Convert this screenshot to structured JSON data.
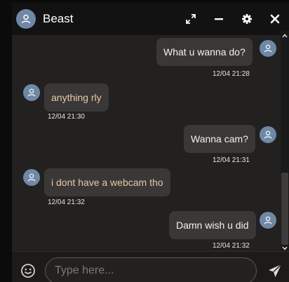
{
  "header": {
    "contact_name": "Beast",
    "expand_icon": "expand-icon",
    "minimize_icon": "minimize-icon",
    "settings_icon": "gear-icon",
    "close_icon": "close-icon"
  },
  "messages": [
    {
      "direction": "outgoing",
      "text": "What u wanna do?",
      "time": "12/04 21:28"
    },
    {
      "direction": "incoming",
      "text": "anything rly",
      "time": "12/04 21:30"
    },
    {
      "direction": "outgoing",
      "text": "Wanna cam?",
      "time": "12/04 21:31"
    },
    {
      "direction": "incoming",
      "text": "i dont have a webcam tho",
      "time": "12/04 21:32"
    },
    {
      "direction": "outgoing",
      "text": "Damn wish u did",
      "time": "12/04 21:32"
    }
  ],
  "composer": {
    "placeholder": "Type here...",
    "emoji_icon": "emoji-icon",
    "send_icon": "send-icon"
  },
  "colors": {
    "header_bg": "#121212",
    "chat_bg": "#232120",
    "bubble_bg": "#3a3836",
    "avatar_bg": "#6f88a6",
    "incoming_text": "#e8c9a8",
    "outgoing_text": "#f2f2f2"
  }
}
